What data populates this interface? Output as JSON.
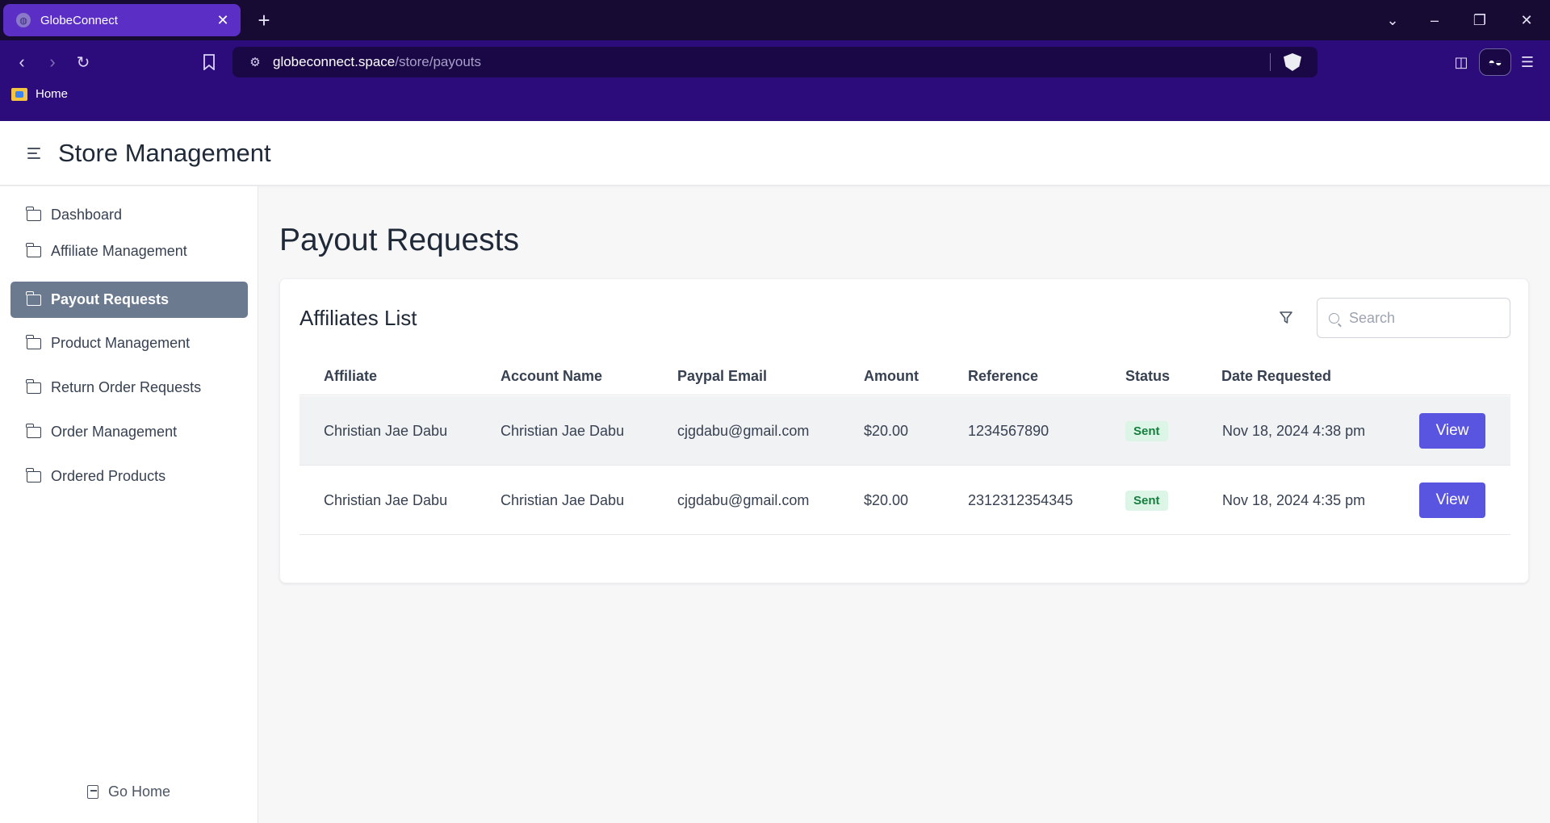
{
  "browser": {
    "tab_title": "GlobeConnect",
    "url_host": "globeconnect.space",
    "url_path": "/store/payouts",
    "bookmark_label": "Home"
  },
  "header": {
    "title": "Store Management"
  },
  "sidebar": {
    "items": [
      {
        "label": "Dashboard",
        "active": false
      },
      {
        "label": "Affiliate Management",
        "active": false
      },
      {
        "label": "Payout Requests",
        "active": true
      },
      {
        "label": "Product Management",
        "active": false
      },
      {
        "label": "Return Order Requests",
        "active": false
      },
      {
        "label": "Order Management",
        "active": false
      },
      {
        "label": "Ordered Products",
        "active": false
      }
    ],
    "go_home_label": "Go Home"
  },
  "main": {
    "page_title": "Payout Requests",
    "card_title": "Affiliates List",
    "search_placeholder": "Search",
    "columns": [
      "Affiliate",
      "Account Name",
      "Paypal Email",
      "Amount",
      "Reference",
      "Status",
      "Date Requested"
    ],
    "rows": [
      {
        "affiliate": "Christian Jae Dabu",
        "account_name": "Christian Jae Dabu",
        "paypal_email": "cjgdabu@gmail.com",
        "amount": "$20.00",
        "reference": "1234567890",
        "status": "Sent",
        "date_requested": "Nov 18, 2024 4:38 pm",
        "action": "View"
      },
      {
        "affiliate": "Christian Jae Dabu",
        "account_name": "Christian Jae Dabu",
        "paypal_email": "cjgdabu@gmail.com",
        "amount": "$20.00",
        "reference": "2312312354345",
        "status": "Sent",
        "date_requested": "Nov 18, 2024 4:35 pm",
        "action": "View"
      }
    ]
  },
  "colors": {
    "accent": "#5955e0",
    "sidebar_active": "#6b7a8f",
    "status_sent_bg": "#dcf5e6",
    "status_sent_text": "#15803d",
    "browser_tab": "#5b2fc6",
    "browser_toolbar": "#2c0c7a"
  }
}
